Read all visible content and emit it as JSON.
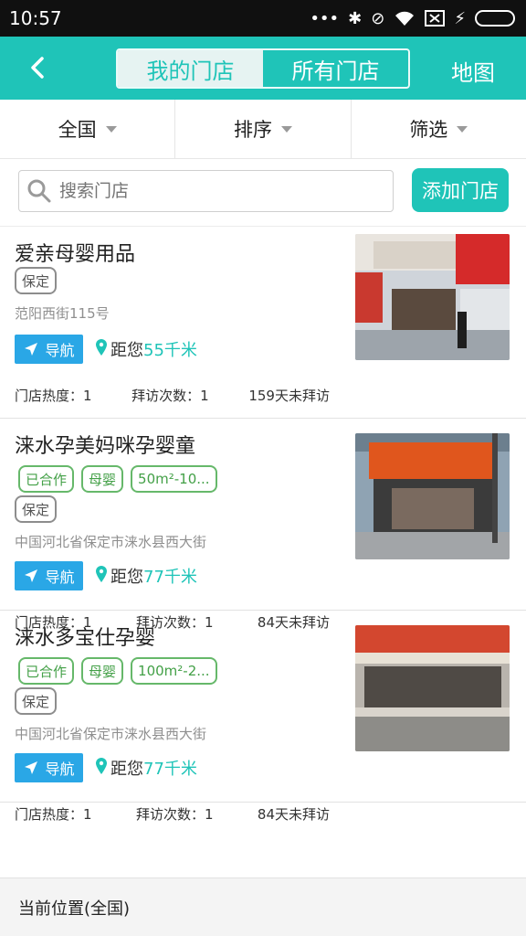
{
  "status_bar": {
    "time": "10:57",
    "icons": [
      "dots-icon",
      "bluetooth-icon",
      "mute-icon",
      "wifi-icon",
      "sim-x-icon",
      "charging-icon",
      "battery-icon"
    ]
  },
  "header": {
    "tabs": [
      {
        "label": "我的门店",
        "active": true
      },
      {
        "label": "所有门店",
        "active": false
      }
    ],
    "map_label": "地图"
  },
  "filters": {
    "items": [
      {
        "label": "全国"
      },
      {
        "label": "排序"
      },
      {
        "label": "筛选"
      }
    ]
  },
  "search": {
    "placeholder": "搜索门店",
    "add_label": "添加门店"
  },
  "stores": [
    {
      "name": "爱亲母婴用品",
      "tags": [],
      "tag_grey": "保定",
      "address": "范阳西街115号",
      "nav_label": "导航",
      "distance_prefix": "距您",
      "distance": "55千米",
      "stats": {
        "heat": "门店热度：1",
        "visits": "拜访次数：1",
        "last": "159天未拜访"
      }
    },
    {
      "name": "涞水孕美妈咪孕婴童",
      "tags": [
        "已合作",
        "母婴",
        "50m²-10..."
      ],
      "tag_grey": "保定",
      "address": "中国河北省保定市涞水县西大街",
      "nav_label": "导航",
      "distance_prefix": "距您",
      "distance": "77千米",
      "stats": {
        "heat": "门店热度：1",
        "visits": "拜访次数：1",
        "last": "84天未拜访"
      }
    },
    {
      "name": "涞水多宝仕孕婴",
      "tags": [
        "已合作",
        "母婴",
        "100m²-2..."
      ],
      "tag_grey": "保定",
      "address": "中国河北省保定市涞水县西大街",
      "nav_label": "导航",
      "distance_prefix": "距您",
      "distance": "77千米",
      "stats": {
        "heat": "门店热度：1",
        "visits": "拜访次数：1",
        "last": "84天未拜访"
      }
    }
  ],
  "footer": {
    "location_label": "当前位置(全国)"
  },
  "colors": {
    "accent": "#1fc4b8",
    "nav_blue": "#2aa7e6",
    "tag_green": "#43a047"
  }
}
